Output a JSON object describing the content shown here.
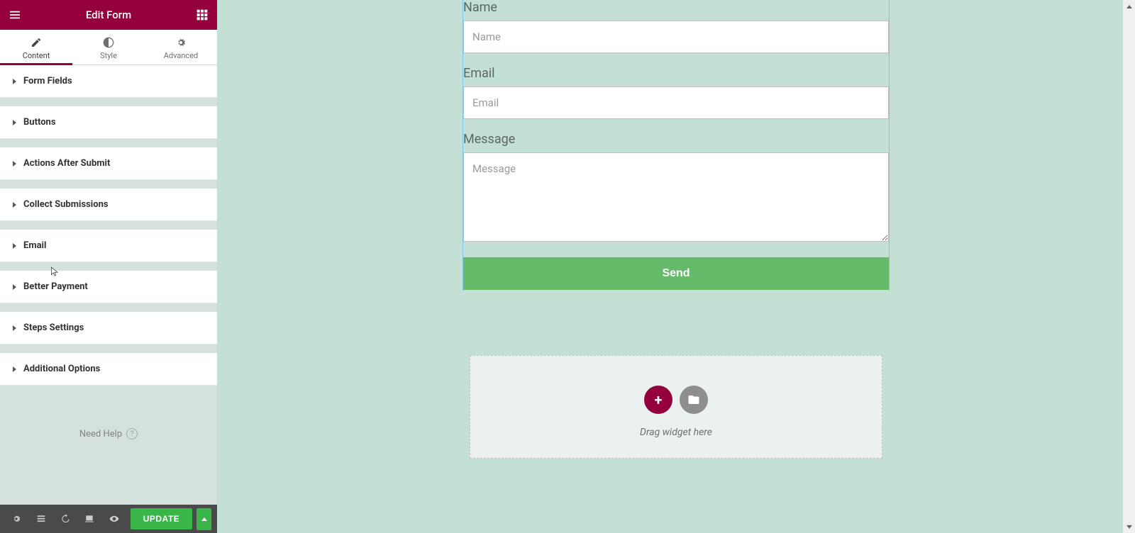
{
  "colors": {
    "brand": "#93003c",
    "accent": "#39b54a",
    "canvasBg": "#c4e0d5"
  },
  "sidebar": {
    "title": "Edit Form",
    "tabs": [
      {
        "label": "Content"
      },
      {
        "label": "Style"
      },
      {
        "label": "Advanced"
      }
    ],
    "sections": [
      {
        "label": "Form Fields"
      },
      {
        "label": "Buttons"
      },
      {
        "label": "Actions After Submit"
      },
      {
        "label": "Collect Submissions"
      },
      {
        "label": "Email"
      },
      {
        "label": "Better Payment"
      },
      {
        "label": "Steps Settings"
      },
      {
        "label": "Additional Options"
      }
    ],
    "help": "Need Help",
    "updateButton": "UPDATE"
  },
  "form": {
    "fields": [
      {
        "label": "Name",
        "placeholder": "Name"
      },
      {
        "label": "Email",
        "placeholder": "Email"
      },
      {
        "label": "Message",
        "placeholder": "Message"
      }
    ],
    "submitLabel": "Send"
  },
  "dropzone": {
    "text": "Drag widget here",
    "addIcon": "+"
  }
}
